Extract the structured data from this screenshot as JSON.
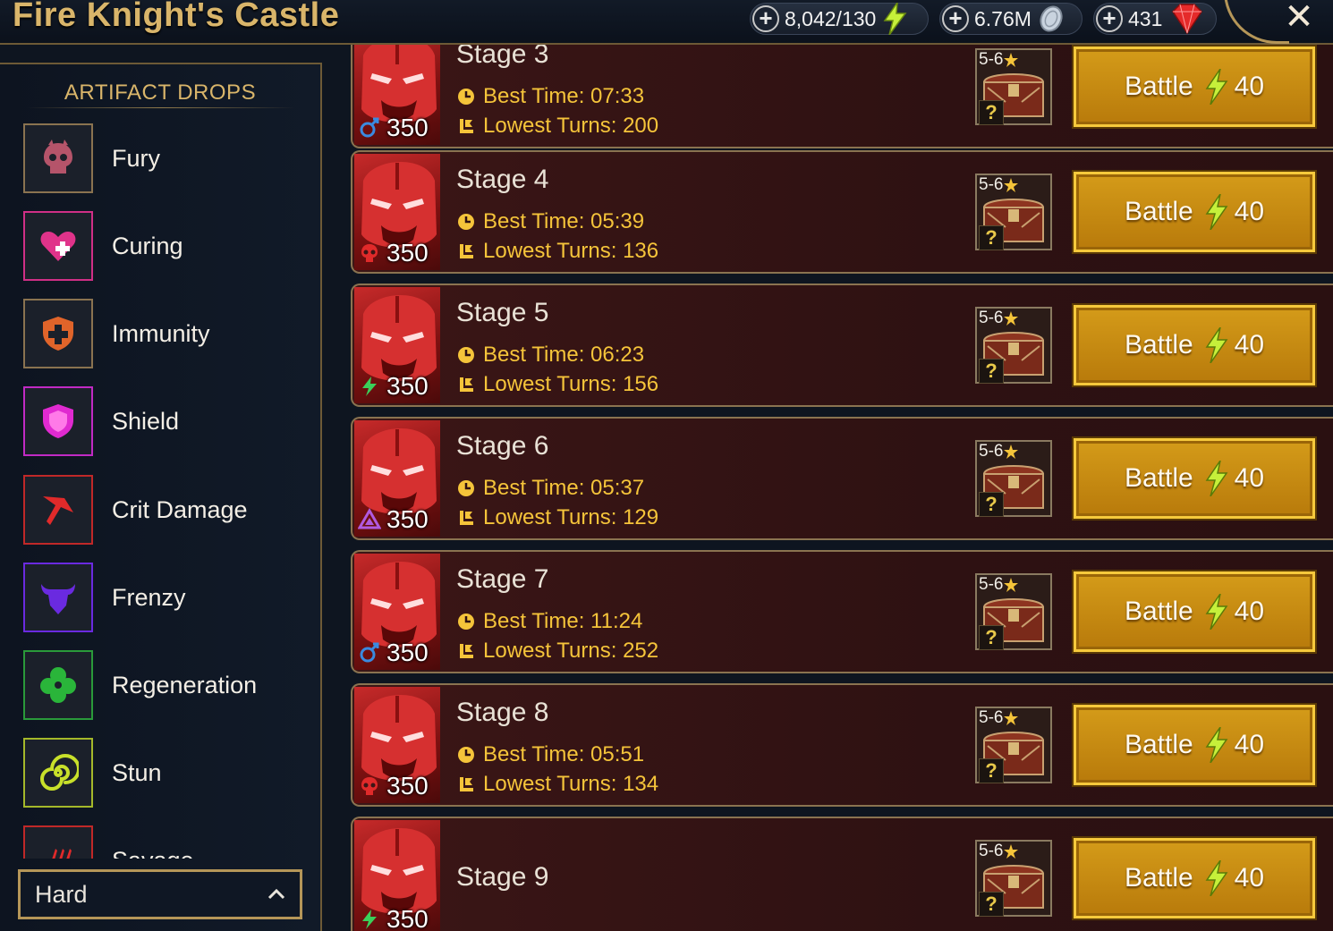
{
  "header": {
    "title": "Fire Knight's Castle",
    "energy": "8,042/130",
    "silver": "6.76M",
    "gems": "431",
    "close_icon": "close-icon"
  },
  "artifact_drops": {
    "title": "ARTIFACT DROPS",
    "sets": [
      {
        "label": "Fury",
        "icon": "fury-skull-icon",
        "color": "#b5546a"
      },
      {
        "label": "Curing",
        "icon": "curing-heart-icon",
        "color": "#e0338a"
      },
      {
        "label": "Immunity",
        "icon": "immunity-shield-cross-icon",
        "color": "#e0642a"
      },
      {
        "label": "Shield",
        "icon": "shield-icon",
        "color": "#e02ad0"
      },
      {
        "label": "Crit Damage",
        "icon": "crit-damage-axe-icon",
        "color": "#e02a2a"
      },
      {
        "label": "Frenzy",
        "icon": "frenzy-bull-icon",
        "color": "#6a2ae0"
      },
      {
        "label": "Regeneration",
        "icon": "regeneration-clover-icon",
        "color": "#2ab53a"
      },
      {
        "label": "Stun",
        "icon": "stun-spiral-icon",
        "color": "#c8e02a"
      },
      {
        "label": "Savage",
        "icon": "savage-claw-icon",
        "color": "#e02a2a"
      }
    ]
  },
  "difficulty": {
    "value": "Hard"
  },
  "stages": [
    {
      "name": "Stage 3",
      "best_time": "Best Time: 07:33",
      "lowest_turns": "Lowest Turns: 200",
      "boss_level": "350",
      "affinity": "magic",
      "rank": "5-6",
      "battle_label": "Battle",
      "cost": "40"
    },
    {
      "name": "Stage 4",
      "best_time": "Best Time: 05:39",
      "lowest_turns": "Lowest Turns: 136",
      "boss_level": "350",
      "affinity": "force",
      "rank": "5-6",
      "battle_label": "Battle",
      "cost": "40"
    },
    {
      "name": "Stage 5",
      "best_time": "Best Time: 06:23",
      "lowest_turns": "Lowest Turns: 156",
      "boss_level": "350",
      "affinity": "spirit",
      "rank": "5-6",
      "battle_label": "Battle",
      "cost": "40"
    },
    {
      "name": "Stage 6",
      "best_time": "Best Time: 05:37",
      "lowest_turns": "Lowest Turns: 129",
      "boss_level": "350",
      "affinity": "void",
      "rank": "5-6",
      "battle_label": "Battle",
      "cost": "40"
    },
    {
      "name": "Stage 7",
      "best_time": "Best Time: 11:24",
      "lowest_turns": "Lowest Turns: 252",
      "boss_level": "350",
      "affinity": "magic",
      "rank": "5-6",
      "battle_label": "Battle",
      "cost": "40"
    },
    {
      "name": "Stage 8",
      "best_time": "Best Time: 05:51",
      "lowest_turns": "Lowest Turns: 134",
      "boss_level": "350",
      "affinity": "force",
      "rank": "5-6",
      "battle_label": "Battle",
      "cost": "40"
    },
    {
      "name": "Stage 9",
      "boss_level": "350",
      "affinity": "spirit",
      "rank": "5-6",
      "battle_label": "Battle",
      "cost": "40"
    }
  ]
}
